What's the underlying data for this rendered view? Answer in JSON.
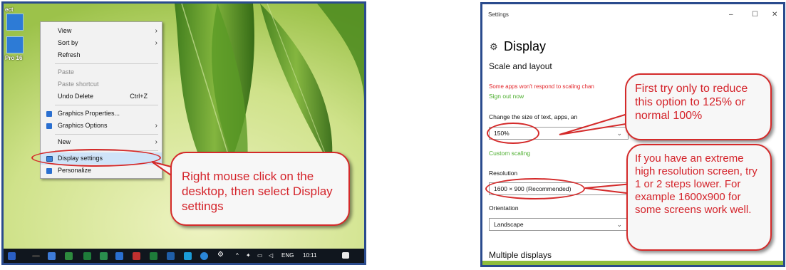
{
  "desktop": {
    "icon_labels": [
      "ect",
      "Pro 16"
    ],
    "context_menu": {
      "items": [
        {
          "label": "View",
          "submenu": true
        },
        {
          "label": "Sort by",
          "submenu": true
        },
        {
          "label": "Refresh"
        },
        {
          "label": "Paste",
          "disabled": true
        },
        {
          "label": "Paste shortcut",
          "disabled": true
        },
        {
          "label": "Undo Delete",
          "shortcut": "Ctrl+Z"
        },
        {
          "label": "Graphics Properties...",
          "icon": "graphics-icon"
        },
        {
          "label": "Graphics Options",
          "submenu": true,
          "icon": "graphics-icon"
        },
        {
          "label": "New",
          "submenu": true
        },
        {
          "label": "Display settings",
          "icon": "display-icon"
        },
        {
          "label": "Personalize",
          "icon": "personalize-icon"
        }
      ]
    },
    "callout": "Right mouse click on the desktop, then select Display settings",
    "taskbar": {
      "language": "ENG",
      "time": "10:11"
    }
  },
  "settings": {
    "window_title": "Settings",
    "controls": {
      "minimize": "–",
      "maximize": "☐",
      "close": "✕"
    },
    "heading": "Display",
    "section": "Scale and layout",
    "warning": "Some apps won't respond to scaling chan",
    "sign_out": "Sign out now",
    "scale_label": "Change the size of text, apps, an",
    "scale_value": "150%",
    "custom_scaling": "Custom scaling",
    "resolution_label": "Resolution",
    "resolution_value": "1600 × 900 (Recommended)",
    "orientation_label": "Orientation",
    "orientation_value": "Landscape",
    "multiple_displays": "Multiple displays"
  },
  "callouts": {
    "scale": "First try only to reduce this option to 125% or normal 100%",
    "resolution": "If you have an extreme high resolution screen, try 1 or 2 steps lower. For example 1600x900 for some screens work well."
  },
  "colors": {
    "accent_red": "#d42a2a",
    "link_green": "#4cae2e",
    "frame_blue": "#2a4b8d"
  }
}
